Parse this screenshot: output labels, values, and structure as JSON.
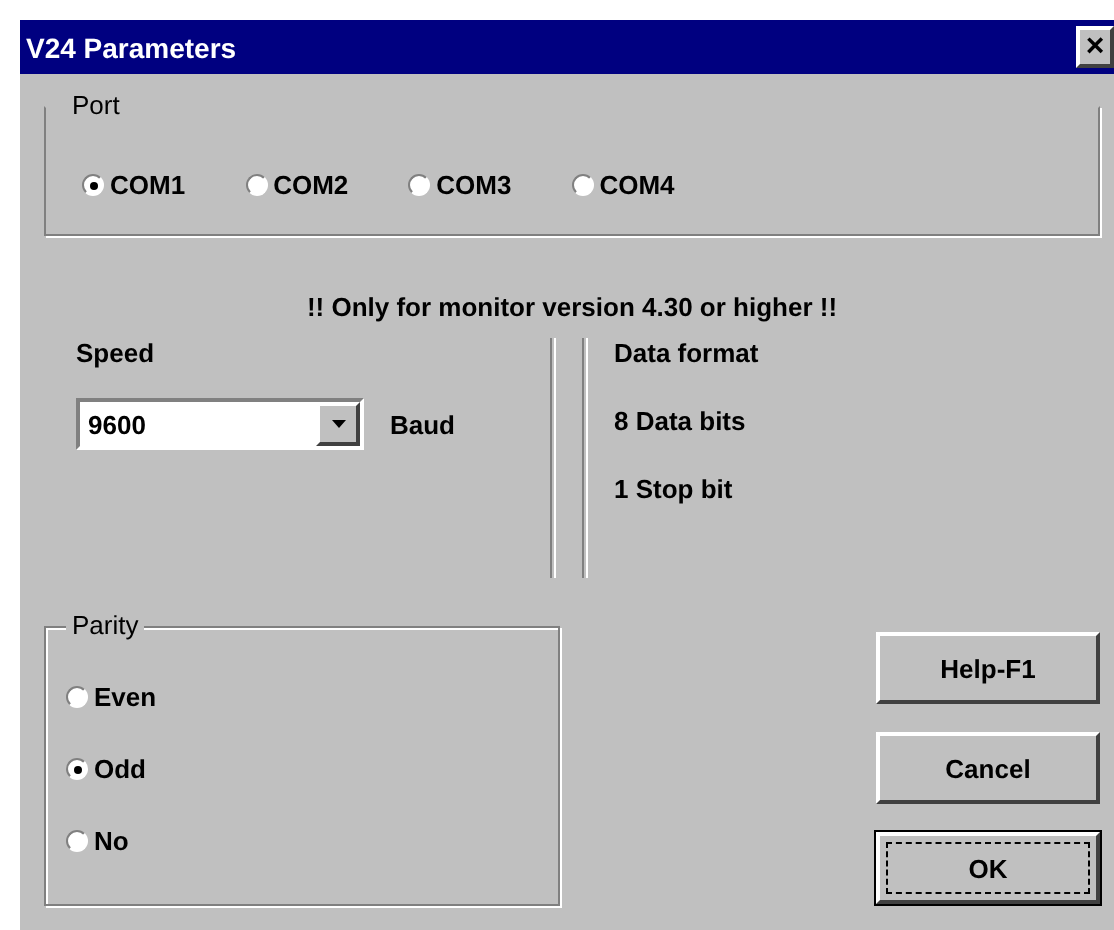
{
  "window": {
    "title": "V24 Parameters",
    "close": "×"
  },
  "port": {
    "label": "Port",
    "options": [
      {
        "label": "COM1",
        "selected": true
      },
      {
        "label": "COM2",
        "selected": false
      },
      {
        "label": "COM3",
        "selected": false
      },
      {
        "label": "COM4",
        "selected": false
      }
    ]
  },
  "note": "!! Only for monitor version 4.30 or higher !!",
  "speed": {
    "label": "Speed",
    "value": "9600",
    "unit": "Baud"
  },
  "data_format": {
    "label": "Data format",
    "lines": [
      "8 Data bits",
      "1 Stop bit"
    ]
  },
  "parity": {
    "label": "Parity",
    "options": [
      {
        "label": "Even",
        "selected": false
      },
      {
        "label": "Odd",
        "selected": true
      },
      {
        "label": "No",
        "selected": false
      }
    ]
  },
  "buttons": [
    {
      "label": "Help-F1",
      "default": false
    },
    {
      "label": "Cancel",
      "default": false
    },
    {
      "label": "OK",
      "default": true
    }
  ]
}
